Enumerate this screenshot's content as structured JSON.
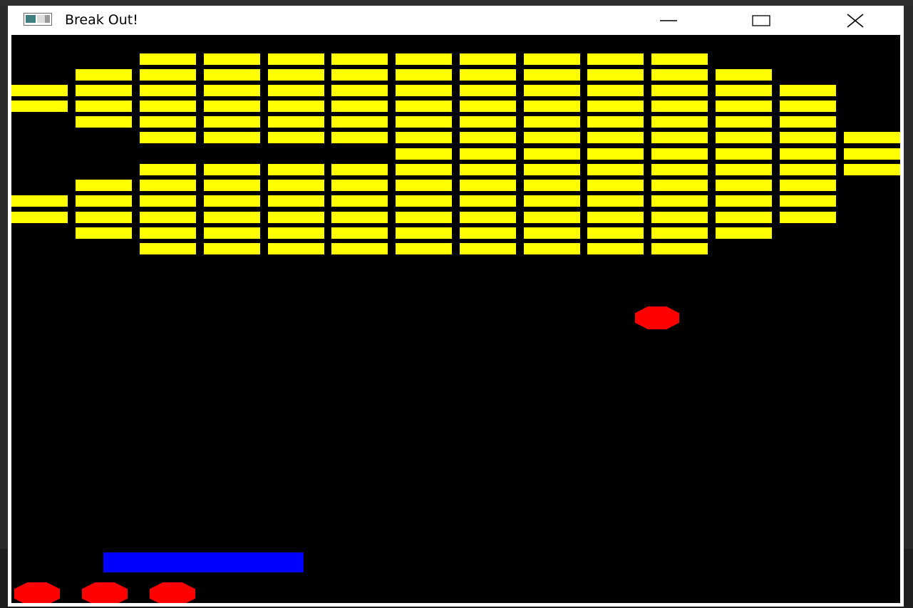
{
  "window": {
    "title": "Break Out!",
    "icon": "app-window-icon",
    "controls": [
      "minimize-icon",
      "maximize-icon",
      "close-icon"
    ]
  },
  "game": {
    "colors": {
      "background": "#000000",
      "brick": "#ffff00",
      "paddle": "#0000ff",
      "ball": "#ff0000"
    },
    "bricks_grid": [
      ".............",
      "..........,..",
      "..........,..",
      "..........,..",
      "..........,..",
      "..........,..",
      "..........,..",
      "..........,..",
      "..........,..",
      "..........,..",
      "..........,..",
      "..........,..",
      "..........,.."
    ],
    "brick_columns": [
      "0000011111100",
      "0111111111111",
      "1111111111111"
    ],
    "lives_remaining": 3
  }
}
